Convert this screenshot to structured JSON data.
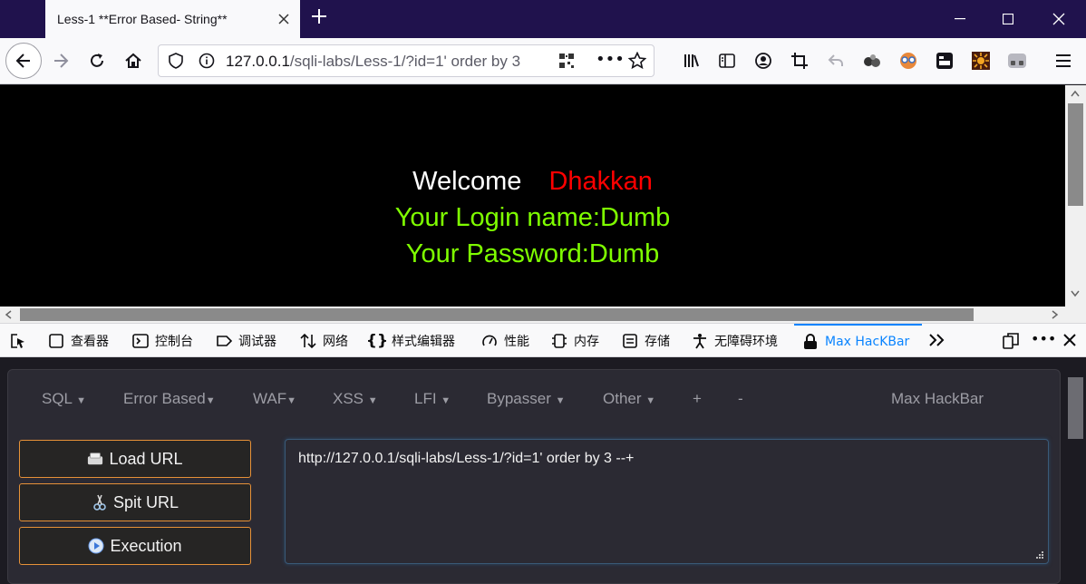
{
  "tab": {
    "title": "Less-1 **Error Based- String**"
  },
  "url": {
    "host": "127.0.0.1",
    "path": "/sqli-labs/Less-1/?id=1' order by 3"
  },
  "page": {
    "welcome": "Welcome",
    "name": "Dhakkan",
    "login_line": "Your Login name:Dumb",
    "password_line": "Your Password:Dumb"
  },
  "devtools": {
    "tabs": [
      "查看器",
      "控制台",
      "调试器",
      "网络",
      "样式编辑器",
      "性能",
      "内存",
      "存储",
      "无障碍环境",
      "Max HacKBar"
    ]
  },
  "hackbar": {
    "menu": [
      "SQL",
      "Error Based",
      "WAF",
      "XSS",
      "LFI",
      "Bypasser",
      "Other",
      "+",
      "-"
    ],
    "brand": "Max HackBar",
    "load_url": "Load URL",
    "split_url": "Spit URL",
    "execution": "Execution",
    "url_value": "http://127.0.0.1/sqli-labs/Less-1/?id=1' order by 3 --+"
  },
  "colors": {
    "accent": "#0a84ff",
    "button_border": "#e69138",
    "welcome_name": "#ff0000",
    "info_text": "#7fff00"
  }
}
